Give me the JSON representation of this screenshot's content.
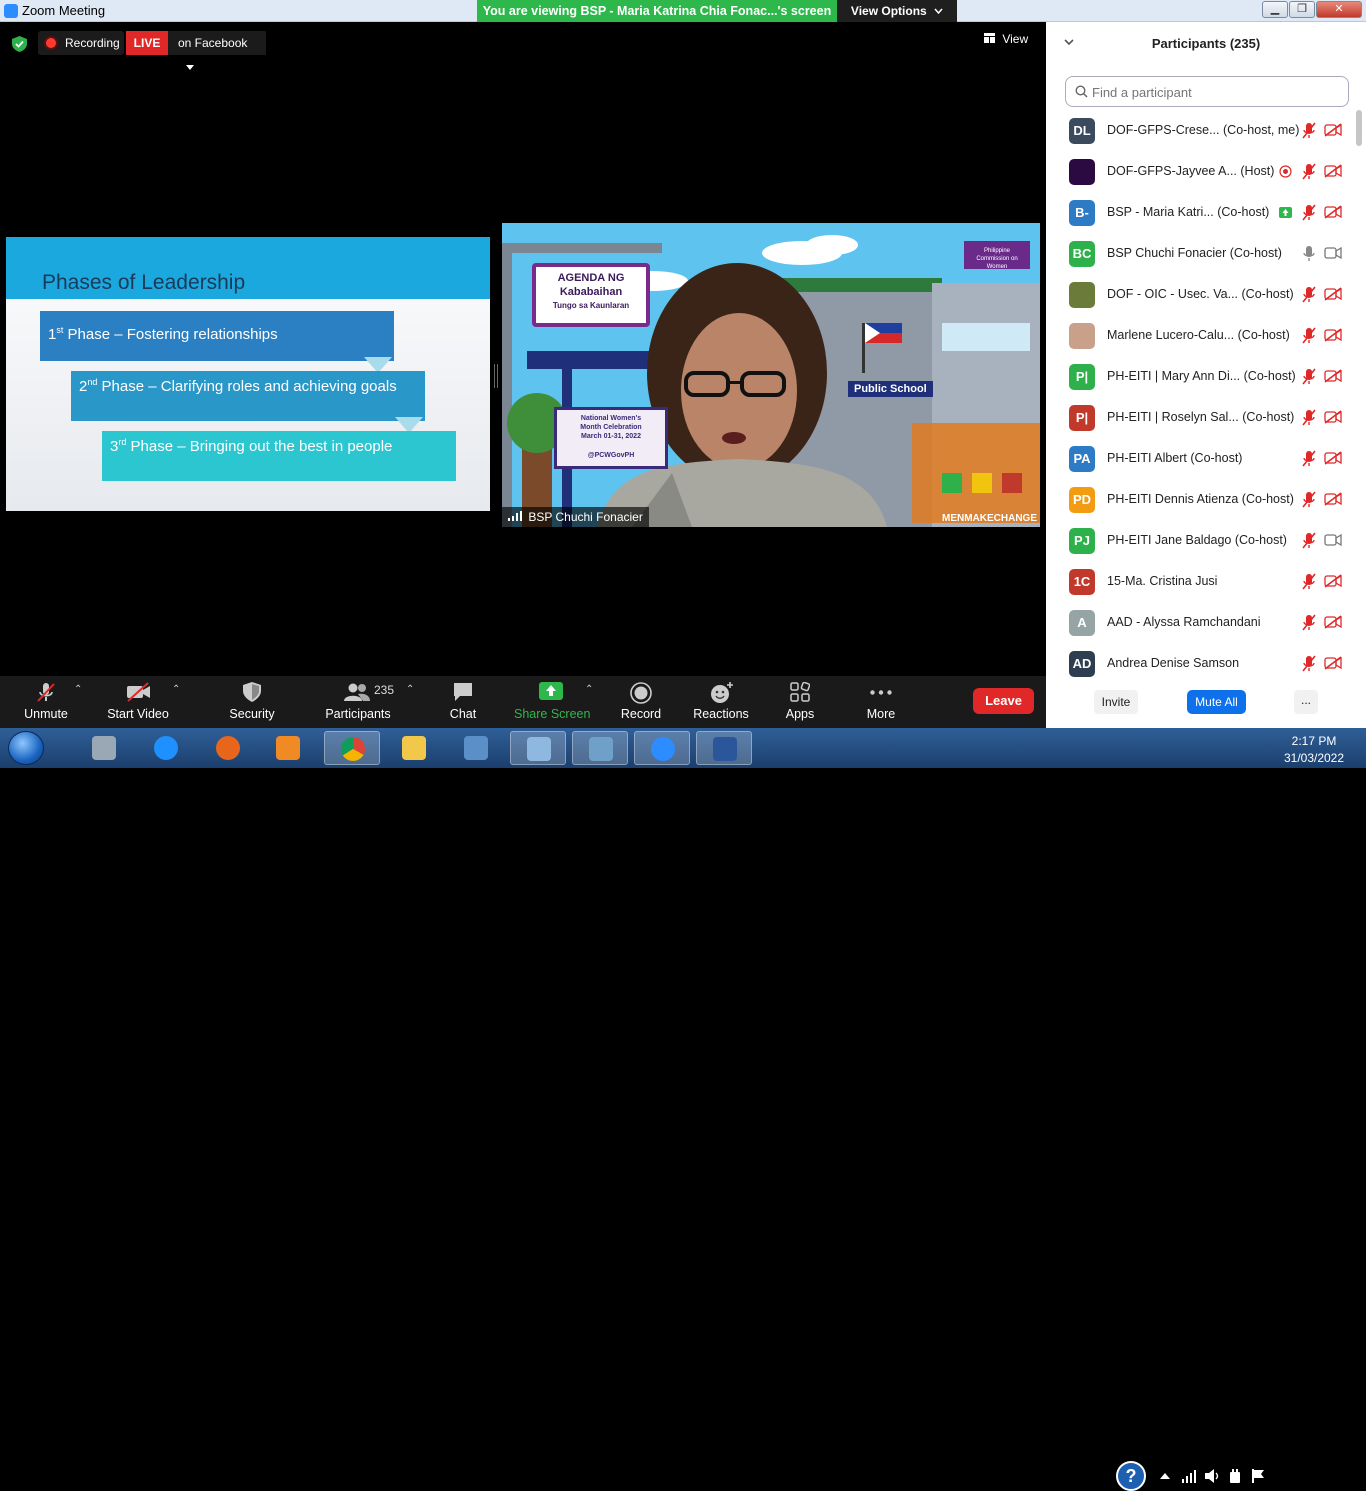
{
  "window": {
    "title": "Zoom Meeting",
    "viewing_banner": "You are viewing BSP - Maria Katrina Chia Fonac...'s screen",
    "view_options": "View Options",
    "btn_minimize": "▁",
    "btn_restore": "❐",
    "btn_close": "✕"
  },
  "meeting_top": {
    "recording_label": "Recording",
    "live_label": "LIVE",
    "facebook_label": "on Facebook",
    "view_label": "View"
  },
  "slide": {
    "title": "Phases of Leadership",
    "phases": [
      {
        "num": "1",
        "sup": "st",
        "text": " Phase – Fostering relationships"
      },
      {
        "num": "2",
        "sup": "nd",
        "text": " Phase – Clarifying roles and achieving goals"
      },
      {
        "num": "3",
        "sup": "rd",
        "text": " Phase – Bringing out the best in people"
      }
    ]
  },
  "video": {
    "speaker_name": "BSP  Chuchi Fonacier",
    "poster_title_1": "AGENDA NG",
    "poster_title_2": "Kababaihan",
    "poster_title_3": "Tungo sa Kaunlaran",
    "event_line_1": "National Women's",
    "event_line_2": "Month Celebration",
    "event_line_3": "March 01-31, 2022",
    "event_handle": "@PCWGovPH",
    "school_sign": "Public School",
    "hashtag": "MENMAKECHANGE",
    "pcw_logo_text": "Philippine Commission on Women"
  },
  "toolbar": {
    "unmute": "Unmute",
    "start_video": "Start Video",
    "security": "Security",
    "participants": "Participants",
    "participants_count": "235",
    "chat": "Chat",
    "share_screen": "Share Screen",
    "record": "Record",
    "reactions": "Reactions",
    "apps": "Apps",
    "more": "More",
    "leave": "Leave"
  },
  "panel": {
    "title": "Participants (235)",
    "search_placeholder": "Find a participant",
    "participants": [
      {
        "initials": "DL",
        "color": "#3b4a5c",
        "name": "DOF-GFPS-Crese...",
        "role": "(Co-host, me)",
        "mic": "muted",
        "cam": "off",
        "indicator": ""
      },
      {
        "initials": "",
        "color": "#2a0a40",
        "name": "DOF-GFPS-Jayvee A...",
        "role": "(Host)",
        "mic": "muted",
        "cam": "off",
        "indicator": "record"
      },
      {
        "initials": "B-",
        "color": "#2c7bc4",
        "name": "BSP - Maria Katri...",
        "role": "(Co-host)",
        "mic": "muted",
        "cam": "off",
        "indicator": "share"
      },
      {
        "initials": "BC",
        "color": "#2eb04b",
        "name": "BSP Chuchi Fonacier",
        "role": "(Co-host)",
        "mic": "on",
        "cam": "on",
        "indicator": ""
      },
      {
        "initials": "",
        "color": "#6a7b3a",
        "name": "DOF - OIC - Usec. Va...",
        "role": "(Co-host)",
        "mic": "muted",
        "cam": "off",
        "indicator": ""
      },
      {
        "initials": "",
        "color": "#c9a08a",
        "name": "Marlene Lucero-Calu...",
        "role": "(Co-host)",
        "mic": "muted",
        "cam": "off",
        "indicator": ""
      },
      {
        "initials": "P|",
        "color": "#2eb04b",
        "name": "PH-EITI | Mary Ann Di...",
        "role": "(Co-host)",
        "mic": "muted",
        "cam": "off",
        "indicator": ""
      },
      {
        "initials": "P|",
        "color": "#c0392b",
        "name": "PH-EITI | Roselyn Sal...",
        "role": "(Co-host)",
        "mic": "muted",
        "cam": "off",
        "indicator": ""
      },
      {
        "initials": "PA",
        "color": "#2c7bc4",
        "name": "PH-EITI Albert",
        "role": "(Co-host)",
        "mic": "muted",
        "cam": "off",
        "indicator": ""
      },
      {
        "initials": "PD",
        "color": "#f39c12",
        "name": "PH-EITI Dennis Atienza",
        "role": "(Co-host)",
        "mic": "muted",
        "cam": "off",
        "indicator": ""
      },
      {
        "initials": "PJ",
        "color": "#2eb04b",
        "name": "PH-EITI Jane Baldago",
        "role": "(Co-host)",
        "mic": "muted",
        "cam": "on",
        "indicator": ""
      },
      {
        "initials": "1C",
        "color": "#c0392b",
        "name": "15-Ma. Cristina Jusi",
        "role": "",
        "mic": "muted",
        "cam": "off",
        "indicator": ""
      },
      {
        "initials": "A",
        "color": "#95a5a6",
        "name": "AAD - Alyssa Ramchandani",
        "role": "",
        "mic": "muted",
        "cam": "off",
        "indicator": ""
      },
      {
        "initials": "AD",
        "color": "#2c3e50",
        "name": "Andrea Denise Samson",
        "role": "",
        "mic": "muted",
        "cam": "off",
        "indicator": ""
      }
    ],
    "invite": "Invite",
    "mute_all": "Mute All",
    "more": "..."
  },
  "taskbar": {
    "help_glyph": "?",
    "time": "2:17 PM",
    "date": "31/03/2022"
  }
}
